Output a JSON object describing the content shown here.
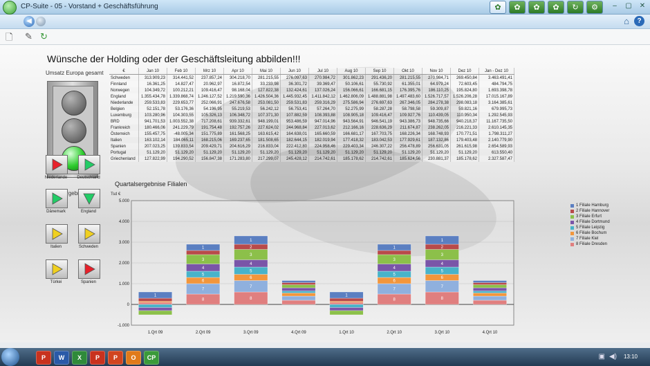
{
  "window": {
    "title": "CP-Suite - 05 - Vorstand + Geschäftsführung"
  },
  "toolbar_icons": [
    "leaf-icon",
    "leaf-icon",
    "leaf-icon",
    "leaf-icon",
    "refresh-icon",
    "gear-icon"
  ],
  "main": {
    "headline": "Wünsche der Holding oder der Geschäftsleitung abbilden!!!",
    "umsatz_label": "Umsatz Europa gesamt",
    "trend_label": "Trend Ergebnisse",
    "chart_title": "Quartalsergebnise Filialen"
  },
  "table": {
    "headers": [
      "€",
      "Jan 10",
      "Feb 10",
      "Mrz 10",
      "Apr 10",
      "Mai 10",
      "Jun 10",
      "Jul 10",
      "Aug 10",
      "Sep 10",
      "Okt 10",
      "Nov 10",
      "Dez 10",
      "Jan - Dez 10"
    ],
    "rows": [
      [
        "Schweden",
        "313.909,23",
        "314.441,52",
        "237.857,24",
        "304.218,70",
        "281.215,55",
        "276.097,63",
        "270.984,72",
        "301.862,23",
        "291.436,20",
        "281.215,55",
        "270.984,71",
        "269.450,84",
        "3.463.491,41"
      ],
      [
        "Finnland",
        "16.361,25",
        "14.827,47",
        "20.962,97",
        "16.872,54",
        "33.233,98",
        "36.301,72",
        "39.369,47",
        "50.106,61",
        "55.730,92",
        "61.355,01",
        "64.979,24",
        "72.603,45",
        "484.794,75"
      ],
      [
        "Norwegen",
        "104.349,72",
        "100.212,21",
        "109.416,47",
        "98.168,04",
        "127.822,38",
        "132.424,61",
        "137.026,24",
        "156.066,61",
        "166.681,15",
        "176.395,76",
        "186.110,25",
        "195.824,80",
        "1.693.398,78"
      ],
      [
        "England",
        "1.355.434,78",
        "1.339.868,74",
        "1.246.127,52",
        "1.219.590,36",
        "1.426.504,36",
        "1.445.932,45",
        "1.411.842,12",
        "1.462.806,09",
        "1.488.881,98",
        "1.497.483,60",
        "1.526.717,57",
        "1.526.206,28",
        "17.015.167,89"
      ],
      [
        "Niederlande",
        "259.533,83",
        "229.653,77",
        "252.066,91",
        "247.676,58",
        "253.081,50",
        "259.531,83",
        "259.316,29",
        "275.586,94",
        "276.697,63",
        "267.346,05",
        "284.278,38",
        "298.083,18",
        "3.164.385,61"
      ],
      [
        "Belgien",
        "52.151,78",
        "53.176,36",
        "54.196,95",
        "55.219,53",
        "56.242,12",
        "56.753,41",
        "57.264,70",
        "52.275,99",
        "58.287,28",
        "58.798,58",
        "59.309,87",
        "59.821,16",
        "679.995,73"
      ],
      [
        "Luxemburg",
        "103.280,96",
        "104.303,55",
        "105.326,13",
        "106.348,72",
        "107.371,30",
        "107.882,59",
        "108.393,88",
        "108.905,18",
        "109.416,47",
        "109.927,76",
        "110.439,05",
        "110.950,34",
        "1.292.545,93"
      ],
      [
        "BRD",
        "941.701,53",
        "1.003.552,38",
        "717.208,61",
        "939.332,61",
        "948.199,01",
        "953.486,59",
        "947.014,96",
        "943.564,91",
        "946.541,19",
        "943.386,73",
        "948.735,66",
        "940.218,37",
        "11.167.735,50"
      ],
      [
        "Frankreich",
        "180.466,06",
        "241.229,79",
        "191.754,48",
        "192.757,26",
        "227.624,02",
        "244.968,84",
        "227.013,62",
        "212.166,16",
        "228.636,29",
        "211.674,87",
        "238.262,05",
        "216.221,33",
        "2.610.145,35"
      ],
      [
        "Österreich",
        "155.457,75",
        "-48.005,34",
        "151.775,89",
        "161.568,25",
        "163.615,42",
        "164.638,01",
        "165.660,59",
        "166.681,17",
        "167.703,75",
        "168.226,34",
        "168.748,93",
        "170.771,51",
        "1.798.311,27"
      ],
      [
        "Italien",
        "163.102,14",
        "184.065,11",
        "168.215,06",
        "169.237,65",
        "181.508,65",
        "182.644,15",
        "182.019,94",
        "177.418,32",
        "183.042,53",
        "177.929,61",
        "187.132,86",
        "179.403,48",
        "2.140.779,90"
      ],
      [
        "Spanien",
        "207.023,25",
        "139.833,54",
        "209.429,71",
        "204.616,29",
        "216.833,04",
        "222.412,80",
        "224.958,46",
        "229.403,34",
        "246.307,22",
        "256.478,89",
        "256.631,05",
        "261.615,98",
        "2.654.589,93"
      ],
      [
        "Portugal",
        "51.129,20",
        "51.129,20",
        "51.129,20",
        "51.129,20",
        "51.129,20",
        "51.129,20",
        "51.129,20",
        "51.129,20",
        "51.129,20",
        "51.129,20",
        "51.129,20",
        "51.129,20",
        "613.550,40"
      ],
      [
        "Griechenland",
        "127.822,99",
        "194.290,52",
        "156.847,38",
        "171.283,80",
        "217.299,07",
        "245.428,12",
        "214.742,61",
        "185.178,62",
        "214.742,61",
        "185.624,56",
        "230.881,37",
        "185.178,62",
        "2.327.587,47"
      ]
    ]
  },
  "trend": [
    {
      "label": "Niederlande",
      "arrow": "right",
      "color": "#e8202a"
    },
    {
      "label": "Deutschland",
      "arrow": "right",
      "color": "#22cc66"
    },
    {
      "label": "Dänemark",
      "arrow": "right",
      "color": "#22cc66"
    },
    {
      "label": "England",
      "arrow": "down",
      "color": "#22cc66"
    },
    {
      "label": "Italien",
      "arrow": "right",
      "color": "#f0d020"
    },
    {
      "label": "Schweden",
      "arrow": "right",
      "color": "#f0d020"
    },
    {
      "label": "Türkei",
      "arrow": "right",
      "color": "#f0d020"
    },
    {
      "label": "Spanien",
      "arrow": "right",
      "color": "#e8202a"
    }
  ],
  "chart_data": {
    "type": "bar",
    "stacked": true,
    "title": "Quartalsergebnise Filialen",
    "ylabel": "Tsd €",
    "ylim": [
      -1000,
      5000
    ],
    "yticks": [
      -1000,
      0,
      1000,
      2000,
      3000,
      4000,
      5000
    ],
    "ytick_labels": [
      "-1.000",
      "0",
      "1.000",
      "2.000",
      "3.000",
      "4.000",
      "5.000"
    ],
    "categories": [
      "1.Qrt 09",
      "2.Qrt 09",
      "3.Qrt 09",
      "4.Qrt 09",
      "1.Qrt 10",
      "2.Qrt 10",
      "3.Qrt 10",
      "4.Qrt 10"
    ],
    "series": [
      {
        "name": "1 Filiale Hamburg",
        "color": "#5b7fc1",
        "values": [
          300,
          300,
          400,
          100,
          300,
          300,
          400,
          100
        ]
      },
      {
        "name": "2 Filiale Hannover",
        "color": "#b84a4a",
        "values": [
          150,
          200,
          250,
          100,
          150,
          200,
          250,
          100
        ]
      },
      {
        "name": "3 Filiale Erfurt",
        "color": "#8cc04a",
        "values": [
          -200,
          450,
          500,
          150,
          -200,
          450,
          500,
          150
        ]
      },
      {
        "name": "4 Filiale Dortmund",
        "color": "#7a55a8",
        "values": [
          -150,
          350,
          350,
          150,
          -150,
          350,
          350,
          150
        ]
      },
      {
        "name": "5 Filiale Leipzig",
        "color": "#48b3c9",
        "values": [
          -150,
          300,
          350,
          100,
          -150,
          300,
          350,
          100
        ]
      },
      {
        "name": "6 Filiale Bochum",
        "color": "#f2963c",
        "values": [
          50,
          300,
          300,
          150,
          50,
          300,
          300,
          150
        ]
      },
      {
        "name": "7 Filiale Kiel",
        "color": "#8fb0de",
        "values": [
          0,
          500,
          550,
          200,
          0,
          500,
          550,
          200
        ]
      },
      {
        "name": "8 Filiale Dresden",
        "color": "#e07f7f",
        "values": [
          100,
          500,
          600,
          200,
          100,
          500,
          600,
          200
        ]
      }
    ],
    "legend_position": "right"
  },
  "taskbar": {
    "clock": "13:10",
    "apps": [
      "P",
      "W",
      "X",
      "P",
      "P",
      "O",
      "CP"
    ]
  }
}
